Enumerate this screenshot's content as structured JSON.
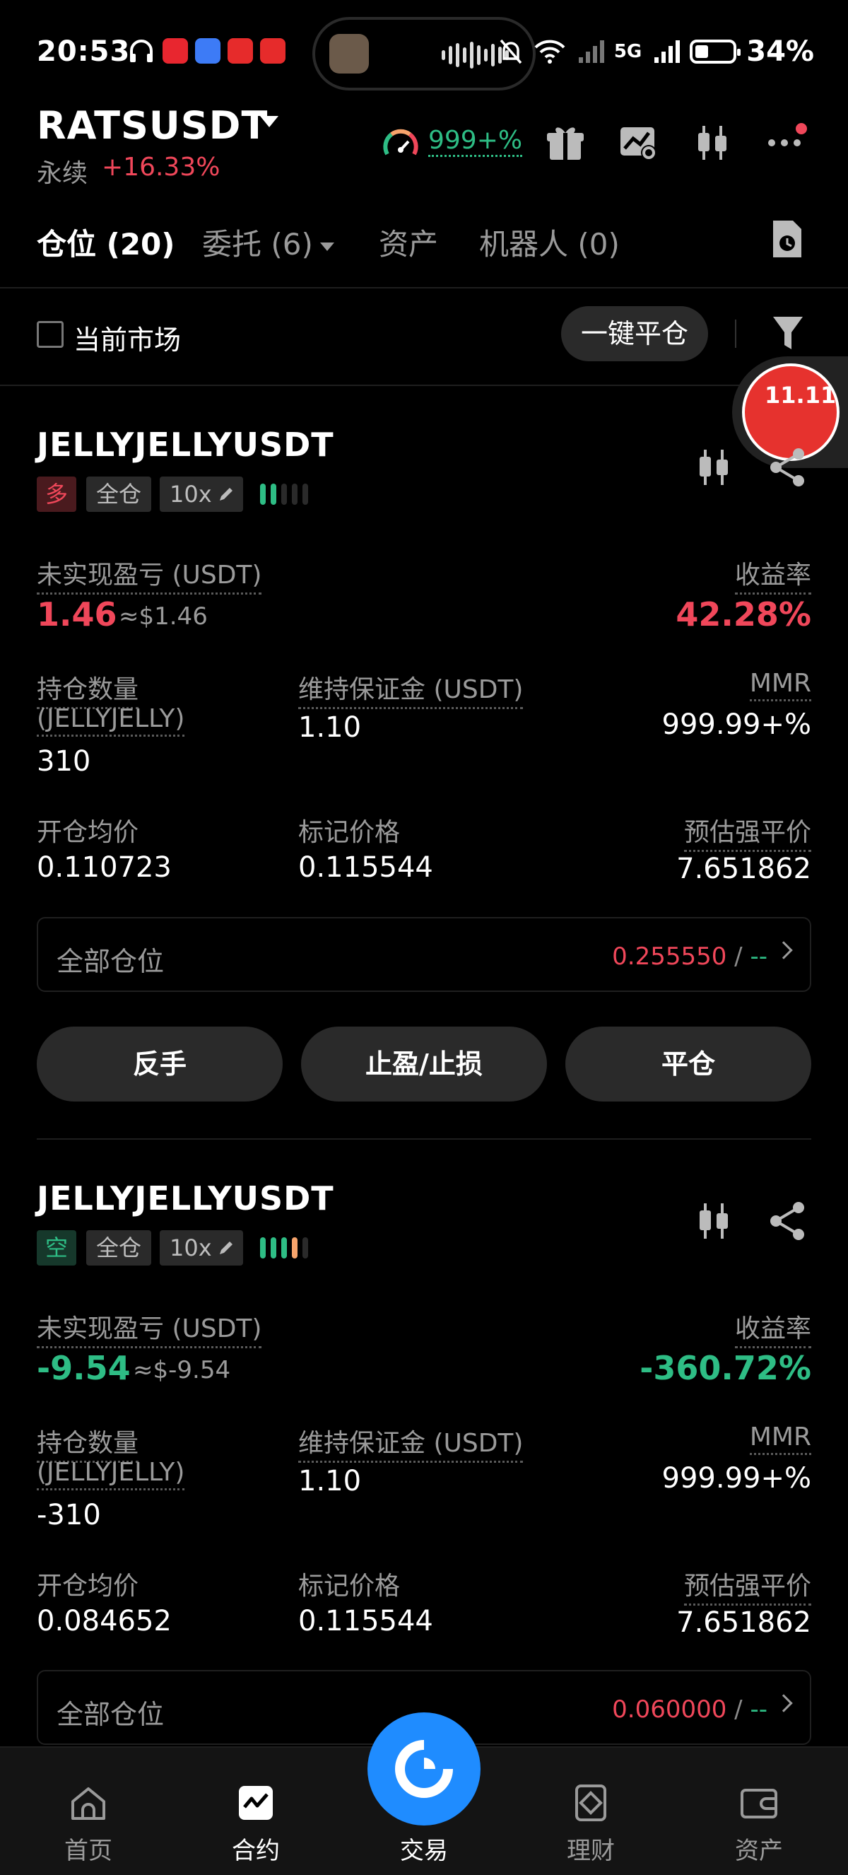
{
  "status_bar": {
    "time": "20:53",
    "network": "5G",
    "battery": "34%"
  },
  "header": {
    "pair": "RATSUSDT",
    "contract_type": "永续",
    "change_pct": "+16.33%",
    "rate_value": "999+%"
  },
  "tabs": [
    {
      "label": "仓位 (20)",
      "active": true
    },
    {
      "label": "委托 (6)",
      "active": false
    },
    {
      "label": "资产",
      "active": false
    },
    {
      "label": "机器人 (0)",
      "active": false
    }
  ],
  "filter": {
    "current_market_label": "当前市场",
    "close_all_label": "一键平仓"
  },
  "float_badge": {
    "text": "11.11"
  },
  "positions": [
    {
      "symbol": "JELLYJELLYUSDT",
      "side": "多",
      "margin_mode": "全仓",
      "leverage": "10x",
      "unrealized_label": "未实现盈亏 (USDT)",
      "unrealized_value": "1.46",
      "unrealized_usd": "≈$1.46",
      "roe_label": "收益率",
      "roe_value": "42.28%",
      "qty_label_1": "持仓数量",
      "qty_label_2": "(JELLYJELLY)",
      "qty_value": "310",
      "mm_label": "维持保证金 (USDT)",
      "mm_value": "1.10",
      "mmr_label": "MMR",
      "mmr_value": "999.99+%",
      "entry_label": "开仓均价",
      "entry_value": "0.110723",
      "mark_label": "标记价格",
      "mark_value": "0.115544",
      "liq_label": "预估强平价",
      "liq_value": "7.651862",
      "all_pos_label": "全部仓位",
      "all_pos_value": "0.255550",
      "all_pos_sep": "/",
      "all_pos_extra": "--",
      "btn_reverse": "反手",
      "btn_tpsl": "止盈/止损",
      "btn_close": "平仓"
    },
    {
      "symbol": "JELLYJELLYUSDT",
      "side": "空",
      "margin_mode": "全仓",
      "leverage": "10x",
      "unrealized_label": "未实现盈亏 (USDT)",
      "unrealized_value": "-9.54",
      "unrealized_usd": "≈$-9.54",
      "roe_label": "收益率",
      "roe_value": "-360.72%",
      "qty_label_1": "持仓数量",
      "qty_label_2": "(JELLYJELLY)",
      "qty_value": "-310",
      "mm_label": "维持保证金 (USDT)",
      "mm_value": "1.10",
      "mmr_label": "MMR",
      "mmr_value": "999.99+%",
      "entry_label": "开仓均价",
      "entry_value": "0.084652",
      "mark_label": "标记价格",
      "mark_value": "0.115544",
      "liq_label": "预估强平价",
      "liq_value": "7.651862",
      "all_pos_label": "全部仓位",
      "all_pos_value": "0.060000",
      "all_pos_sep": "/",
      "all_pos_extra": "--"
    }
  ],
  "bottom_nav": [
    {
      "label": "首页",
      "icon": "home-icon"
    },
    {
      "label": "合约",
      "icon": "futures-icon"
    },
    {
      "label": "交易",
      "icon": "trade-icon"
    },
    {
      "label": "理财",
      "icon": "earn-icon"
    },
    {
      "label": "资产",
      "icon": "wallet-icon"
    }
  ],
  "colors": {
    "profit": "#f0475a",
    "loss": "#2ebd85",
    "liq": "#f7a46c",
    "accent": "#1f8cff"
  }
}
